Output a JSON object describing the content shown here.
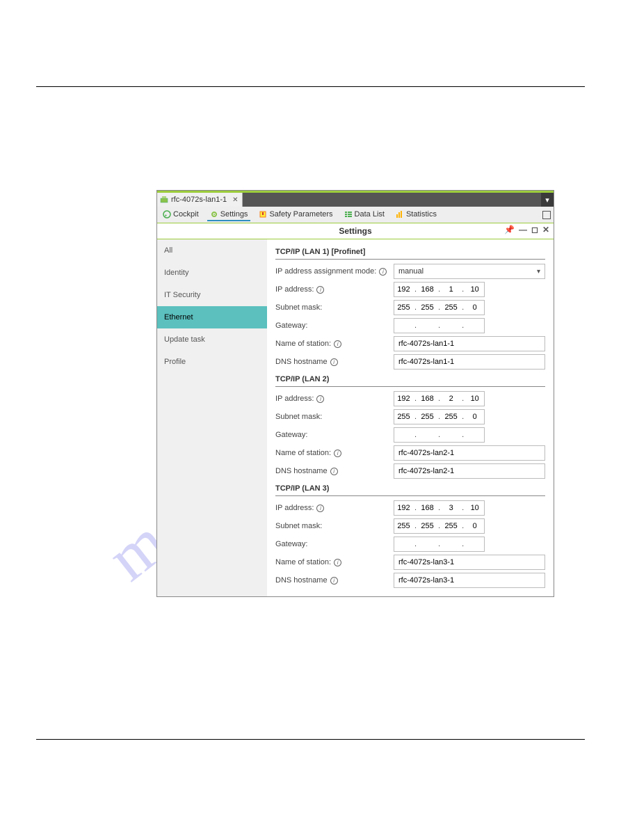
{
  "watermark": "manualchive.com",
  "tab": {
    "title": "rfc-4072s-lan1-1"
  },
  "toolbar": {
    "cockpit": "Cockpit",
    "settings": "Settings",
    "safety": "Safety Parameters",
    "datalist": "Data List",
    "statistics": "Statistics"
  },
  "panel_title": "Settings",
  "sidebar": {
    "items": [
      {
        "label": "All"
      },
      {
        "label": "Identity"
      },
      {
        "label": "IT Security"
      },
      {
        "label": "Ethernet"
      },
      {
        "label": "Update task"
      },
      {
        "label": "Profile"
      }
    ],
    "active_index": 3
  },
  "sections": [
    {
      "title": "TCP/IP (LAN 1) [Profinet]",
      "mode": {
        "label": "IP address assignment mode:",
        "value": "manual"
      },
      "ip": {
        "label": "IP address:",
        "o": [
          "192",
          "168",
          "1",
          "10"
        ]
      },
      "subnet": {
        "label": "Subnet mask:",
        "o": [
          "255",
          "255",
          "255",
          "0"
        ]
      },
      "gateway": {
        "label": "Gateway:",
        "o": [
          "",
          "",
          "",
          ""
        ]
      },
      "station": {
        "label": "Name of station:",
        "value": "rfc-4072s-lan1-1"
      },
      "dns": {
        "label": "DNS hostname",
        "value": "rfc-4072s-lan1-1"
      }
    },
    {
      "title": "TCP/IP (LAN 2)",
      "ip": {
        "label": "IP address:",
        "o": [
          "192",
          "168",
          "2",
          "10"
        ]
      },
      "subnet": {
        "label": "Subnet mask:",
        "o": [
          "255",
          "255",
          "255",
          "0"
        ]
      },
      "gateway": {
        "label": "Gateway:",
        "o": [
          "",
          "",
          "",
          ""
        ]
      },
      "station": {
        "label": "Name of station:",
        "value": "rfc-4072s-lan2-1"
      },
      "dns": {
        "label": "DNS hostname",
        "value": "rfc-4072s-lan2-1"
      }
    },
    {
      "title": "TCP/IP (LAN 3)",
      "ip": {
        "label": "IP address:",
        "o": [
          "192",
          "168",
          "3",
          "10"
        ]
      },
      "subnet": {
        "label": "Subnet mask:",
        "o": [
          "255",
          "255",
          "255",
          "0"
        ]
      },
      "gateway": {
        "label": "Gateway:",
        "o": [
          "",
          "",
          "",
          ""
        ]
      },
      "station": {
        "label": "Name of station:",
        "value": "rfc-4072s-lan3-1"
      },
      "dns": {
        "label": "DNS hostname",
        "value": "rfc-4072s-lan3-1"
      }
    }
  ]
}
